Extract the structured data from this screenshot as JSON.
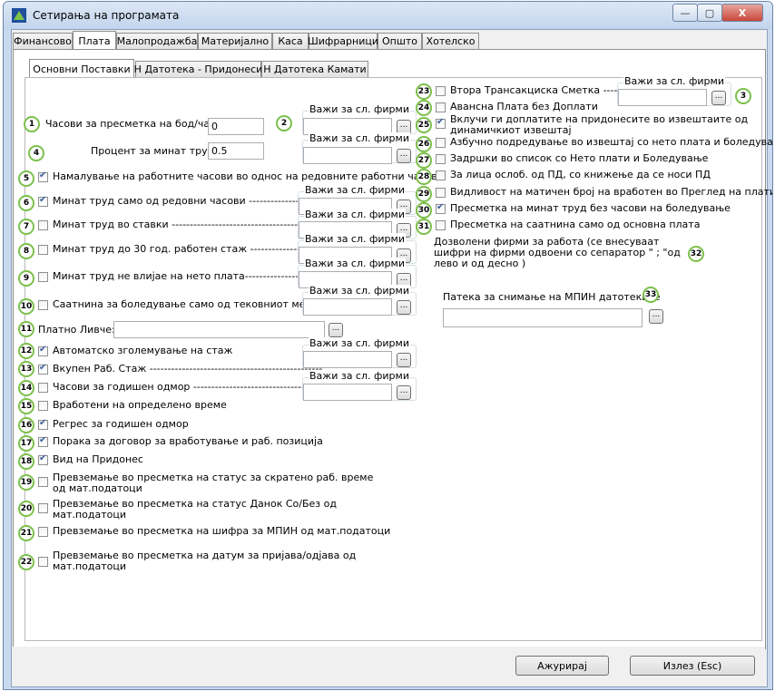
{
  "window": {
    "title": "Сетирања на програмата",
    "minimize": "—",
    "maximize": "▢",
    "close": "X"
  },
  "tabs": [
    "Финансово",
    "Плата",
    "Малопродажба",
    "Материјално",
    "Каса",
    "Шифрарници",
    "Општо",
    "Хотелско"
  ],
  "active_tab": "Плата",
  "subtabs": [
    "Основни Поставки",
    "Н Датотека - Придонеси",
    "Н Датотека Камати"
  ],
  "active_subtab": "Основни Поставки",
  "group_label": "Важи за сл. фирми",
  "ellipsis": "...",
  "fields": {
    "hours_label": "Часови за пресметка на бод/час",
    "hours_value": "0",
    "percent_label": "Процент за минат труд",
    "percent_value": "0.5",
    "payslip_label": "Платно Ливче:",
    "payslip_value": "",
    "allowed_firms_label": "Дозволени фирми за работа (се внесуваат шифри на фирми одвоени со сепаратор \" ; \"од лево и од десно )",
    "mpin_path_label": "Патека за снимање на МПИН датотеките",
    "mpin_path_value": ""
  },
  "left_checks": [
    {
      "n": "5",
      "label": "Намалување на работните часови во однос на редовните работни часови",
      "checked": true
    },
    {
      "n": "6",
      "label": "Минат труд само од редовни часови ----------------------",
      "checked": true
    },
    {
      "n": "7",
      "label": "Минат труд во ставки ---------------------------------------------------",
      "checked": false
    },
    {
      "n": "8",
      "label": "Минат труд до 30 год. работен стаж ---------------------",
      "checked": false
    },
    {
      "n": "9",
      "label": "Минат труд не влијае на нето плата-----------------------",
      "checked": false
    },
    {
      "n": "10",
      "label": "Саатнина за боледување само од тековниот месец",
      "checked": false
    },
    {
      "n": "12",
      "label": "Автоматско зголемување на стаж",
      "checked": true
    },
    {
      "n": "13",
      "label": "Вкупен Раб. Стаж ------------------------------------------------",
      "checked": true
    },
    {
      "n": "14",
      "label": "Часови за годишен одмор ------------------------------------",
      "checked": false
    },
    {
      "n": "15",
      "label": "Вработени на определено време",
      "checked": false
    },
    {
      "n": "16",
      "label": "Регрес за годишен одмор",
      "checked": true
    },
    {
      "n": "17",
      "label": "Порака за договор за вработување и раб. позиција",
      "checked": true
    },
    {
      "n": "18",
      "label": "Вид на Придонес",
      "checked": true
    },
    {
      "n": "19",
      "label": "Превземање во пресметка на статус за скратено раб. време\nод мат.податоци",
      "checked": false
    },
    {
      "n": "20",
      "label": "Превземање во пресметка на статус Данок Со/Без од\nмат.податоци",
      "checked": false
    },
    {
      "n": "21",
      "label": "Превземање во пресметка на шифра за МПИН од мат.податоци",
      "checked": false
    },
    {
      "n": "22",
      "label": "Превземање во пресметка на датум за пријава/одјава од\nмат.податоци",
      "checked": false
    }
  ],
  "right_checks": [
    {
      "n": "23",
      "label": "Втора Трансакциска Сметка ------",
      "checked": false
    },
    {
      "n": "24",
      "label": "Авансна Плата без Доплати",
      "checked": false
    },
    {
      "n": "25",
      "label": "Вклучи ги доплатите на придонесите во извештаите од\nдинамичкиот извештај",
      "checked": true
    },
    {
      "n": "26",
      "label": "Азбучно подредување во извештај со нето плата и боледување",
      "checked": false
    },
    {
      "n": "27",
      "label": "Задршки во список со Нето плати и Боледување",
      "checked": false
    },
    {
      "n": "28",
      "label": "За лица ослоб. од ПД, со книжење да се носи ПД",
      "checked": false
    },
    {
      "n": "29",
      "label": "Видливост на матичен број на вработен во Преглед на плати",
      "checked": false
    },
    {
      "n": "30",
      "label": "Пресметка на минат труд без часови на боледување",
      "checked": true
    },
    {
      "n": "31",
      "label": "Пресметка на саатнина само од основна плата",
      "checked": false
    }
  ],
  "markers": {
    "m1": "1",
    "m2": "2",
    "m3": "3",
    "m4": "4",
    "m11": "11",
    "m32": "32",
    "m33": "33"
  },
  "buttons": {
    "update": "Ажурирај",
    "exit": "Излез (Esc)"
  }
}
